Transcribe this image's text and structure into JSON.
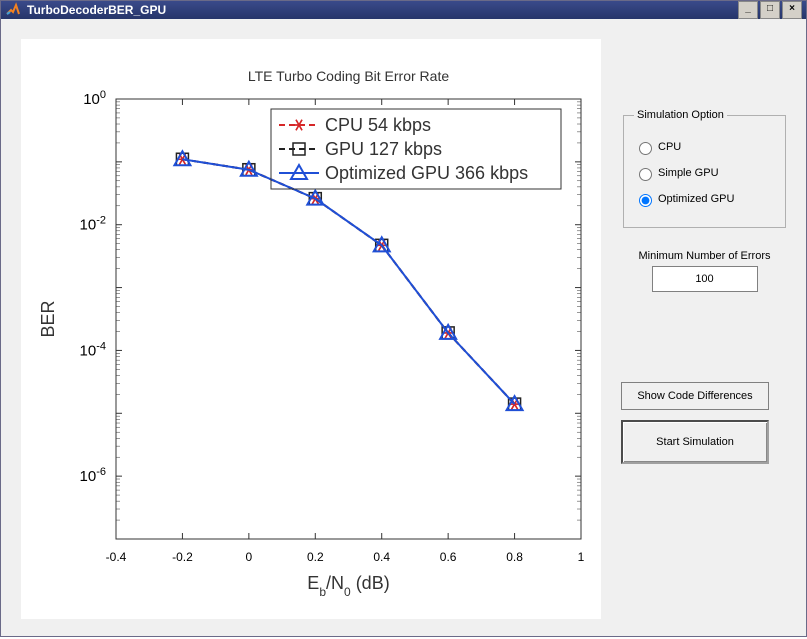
{
  "window": {
    "title": "TurboDecoderBER_GPU"
  },
  "chart_data": {
    "type": "line",
    "title": "LTE Turbo Coding Bit Error Rate",
    "xlabel": "E_b/N_0 (dB)",
    "ylabel": "BER",
    "xlim": [
      -0.4,
      1.0
    ],
    "xticks": [
      "-0.4",
      "-0.2",
      "0",
      "0.2",
      "0.4",
      "0.6",
      "0.8",
      "1"
    ],
    "ylim_exp": [
      -7,
      0
    ],
    "ytick_exps": [
      0,
      -2,
      -4,
      -6
    ],
    "x": [
      -0.2,
      0,
      0.2,
      0.4,
      0.6,
      0.8
    ],
    "series": [
      {
        "name": "CPU 54 kbps",
        "color": "#d62728",
        "marker": "star",
        "dash": "6,4",
        "values": [
          0.11,
          0.075,
          0.026,
          0.0047,
          0.00019,
          1.4e-05
        ]
      },
      {
        "name": "GPU 127 kbps",
        "color": "#222222",
        "marker": "square",
        "dash": "6,4",
        "values": [
          0.11,
          0.075,
          0.026,
          0.0047,
          0.00019,
          1.4e-05
        ]
      },
      {
        "name": "Optimized GPU 366 kbps",
        "color": "#1f4fd6",
        "marker": "triangle",
        "dash": "",
        "values": [
          0.11,
          0.075,
          0.026,
          0.0047,
          0.00019,
          1.4e-05
        ]
      }
    ]
  },
  "sim_option": {
    "legend": "Simulation Option",
    "options": [
      {
        "label": "CPU",
        "checked": false
      },
      {
        "label": "Simple GPU",
        "checked": false
      },
      {
        "label": "Optimized GPU",
        "checked": true
      }
    ]
  },
  "min_errors": {
    "label": "Minimum Number of Errors",
    "value": "100"
  },
  "buttons": {
    "show_diff": "Show Code Differences",
    "start": "Start Simulation"
  }
}
